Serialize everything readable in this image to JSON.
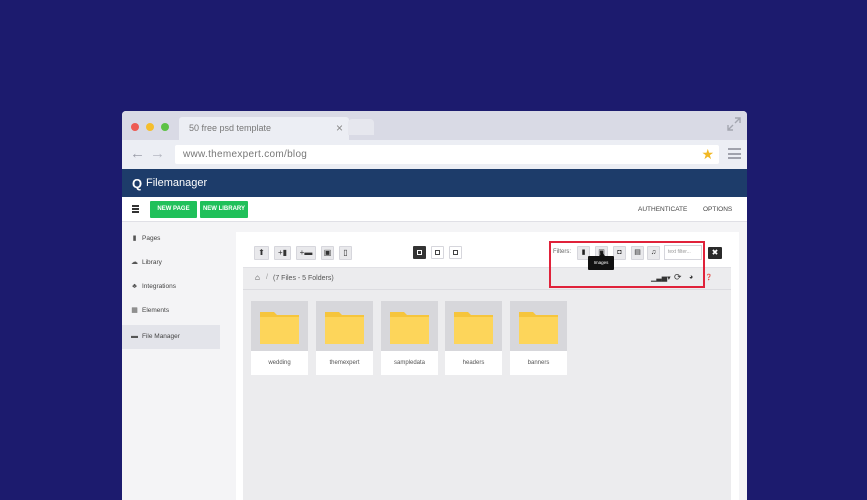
{
  "browser": {
    "tab_title": "50 free psd  template",
    "tab_close": "×",
    "url": "www.themexpert.com/blog",
    "back": "←",
    "forward": "→",
    "star": "★"
  },
  "app": {
    "logo_glyph": "Q",
    "title": "Filemanager"
  },
  "toolbar": {
    "new_page": "NEW PAGE",
    "new_library": "NEW LIBRARY",
    "authenticate": "AUTHENTICATE",
    "options": "OPTIONS"
  },
  "sidebar": {
    "items": [
      {
        "label": "Pages",
        "icon": "page-icon",
        "glyph": "▮"
      },
      {
        "label": "Library",
        "icon": "cloud-icon",
        "glyph": "☁"
      },
      {
        "label": "Integrations",
        "icon": "puzzle-icon",
        "glyph": "♣"
      },
      {
        "label": "Elements",
        "icon": "grid-icon",
        "glyph": "▦"
      },
      {
        "label": "File Manager",
        "icon": "file-icon",
        "glyph": "▬"
      }
    ],
    "active_index": 4
  },
  "file_manager": {
    "tools": [
      {
        "icon": "upload-icon",
        "glyph": "⬆"
      },
      {
        "icon": "new-file-icon",
        "glyph": "+▮"
      },
      {
        "icon": "new-folder-icon",
        "glyph": "+▬"
      },
      {
        "icon": "paste-icon",
        "glyph": "▣"
      },
      {
        "icon": "trash-icon",
        "glyph": "▯"
      }
    ],
    "filters_label": "Filters:",
    "filters": [
      {
        "icon": "file-filter-icon",
        "glyph": "▮"
      },
      {
        "icon": "image-filter-icon",
        "glyph": "▣"
      },
      {
        "icon": "audio-filter-icon",
        "glyph": "◘"
      },
      {
        "icon": "video-filter-icon",
        "glyph": "▤"
      },
      {
        "icon": "music-filter-icon",
        "glyph": "♫"
      }
    ],
    "filter_placeholder": "text filter...",
    "clear_glyph": "✖",
    "tooltip": "Images",
    "home_glyph": "⌂",
    "separator": "/",
    "summary": "(7 Files - 5 Folders)",
    "sort_glyph": "▁▃▅▾",
    "refresh_glyph": "⟳",
    "globe_glyph": "◕",
    "help_glyph": "❓",
    "folders": [
      "wedding",
      "themexpert",
      "sampledata",
      "headers",
      "banners"
    ],
    "folder_color": "#fdd55a",
    "folder_tab_color": "#f6c53c"
  },
  "colors": {
    "background": "#1c1b6e",
    "app_header": "#1d3c6a",
    "accent_green": "#20c05a",
    "highlight_red": "#e0223a"
  }
}
